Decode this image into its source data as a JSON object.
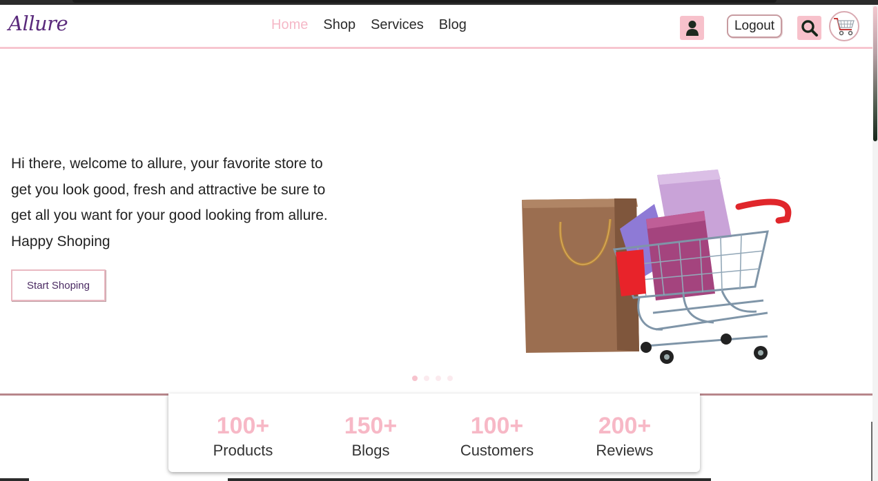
{
  "brand": {
    "logo": "Allure"
  },
  "nav": {
    "links": [
      {
        "label": "Home",
        "active": true
      },
      {
        "label": "Shop",
        "active": false
      },
      {
        "label": "Services",
        "active": false
      },
      {
        "label": "Blog",
        "active": false
      }
    ],
    "logout_label": "Logout",
    "icons": [
      "user-icon",
      "search-icon",
      "cart-icon"
    ]
  },
  "hero": {
    "lines": [
      "Hi there, welcome to allure, your favorite store to",
      "get you look good, fresh and attractive be sure to",
      "get all you want for your good looking from allure.",
      "Happy Shoping"
    ],
    "cta_label": "Start Shoping",
    "carousel": {
      "slides": 4,
      "active_index": 0
    }
  },
  "stats": [
    {
      "value": "100+",
      "label": "Products"
    },
    {
      "value": "150+",
      "label": "Blogs"
    },
    {
      "value": "100+",
      "label": "Customers"
    },
    {
      "value": "200+",
      "label": "Reviews"
    }
  ],
  "colors": {
    "accent_pink": "#f7c1cb",
    "brand_purple": "#5a2a7c",
    "stat_pink": "#f7b8c6"
  }
}
